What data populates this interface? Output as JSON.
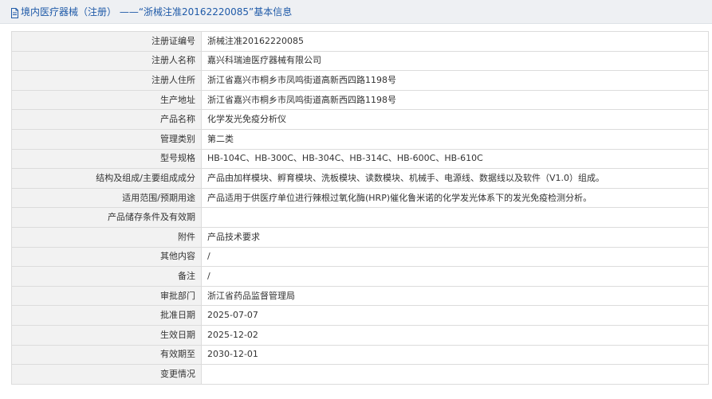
{
  "header": {
    "title": "境内医疗器械（注册） ——“浙械注准20162220085”基本信息",
    "icon": "document-icon"
  },
  "rows": [
    {
      "label": "注册证编号",
      "value": "浙械注准20162220085"
    },
    {
      "label": "注册人名称",
      "value": "嘉兴科瑞迪医疗器械有限公司"
    },
    {
      "label": "注册人住所",
      "value": "浙江省嘉兴市桐乡市凤鸣街道高新西四路1198号"
    },
    {
      "label": "生产地址",
      "value": "浙江省嘉兴市桐乡市凤鸣街道高新西四路1198号"
    },
    {
      "label": "产品名称",
      "value": "化学发光免疫分析仪"
    },
    {
      "label": "管理类别",
      "value": "第二类"
    },
    {
      "label": "型号规格",
      "value": "HB-104C、HB-300C、HB-304C、HB-314C、HB-600C、HB-610C"
    },
    {
      "label": "结构及组成/主要组成成分",
      "value": "产品由加样模块、孵育模块、洗板模块、读数模块、机械手、电源线、数据线以及软件（V1.0）组成。"
    },
    {
      "label": "适用范围/预期用途",
      "value": "产品适用于供医疗单位进行辣根过氧化酶(HRP)催化鲁米诺的化学发光体系下的发光免疫检测分析。"
    },
    {
      "label": "产品储存条件及有效期",
      "value": ""
    },
    {
      "label": "附件",
      "value": "产品技术要求"
    },
    {
      "label": "其他内容",
      "value": "/"
    },
    {
      "label": "备注",
      "value": "/"
    },
    {
      "label": "审批部门",
      "value": "浙江省药品监督管理局"
    },
    {
      "label": "批准日期",
      "value": "2025-07-07"
    },
    {
      "label": "生效日期",
      "value": "2025-12-02"
    },
    {
      "label": "有效期至",
      "value": "2030-12-01"
    },
    {
      "label": "变更情况",
      "value": ""
    }
  ]
}
